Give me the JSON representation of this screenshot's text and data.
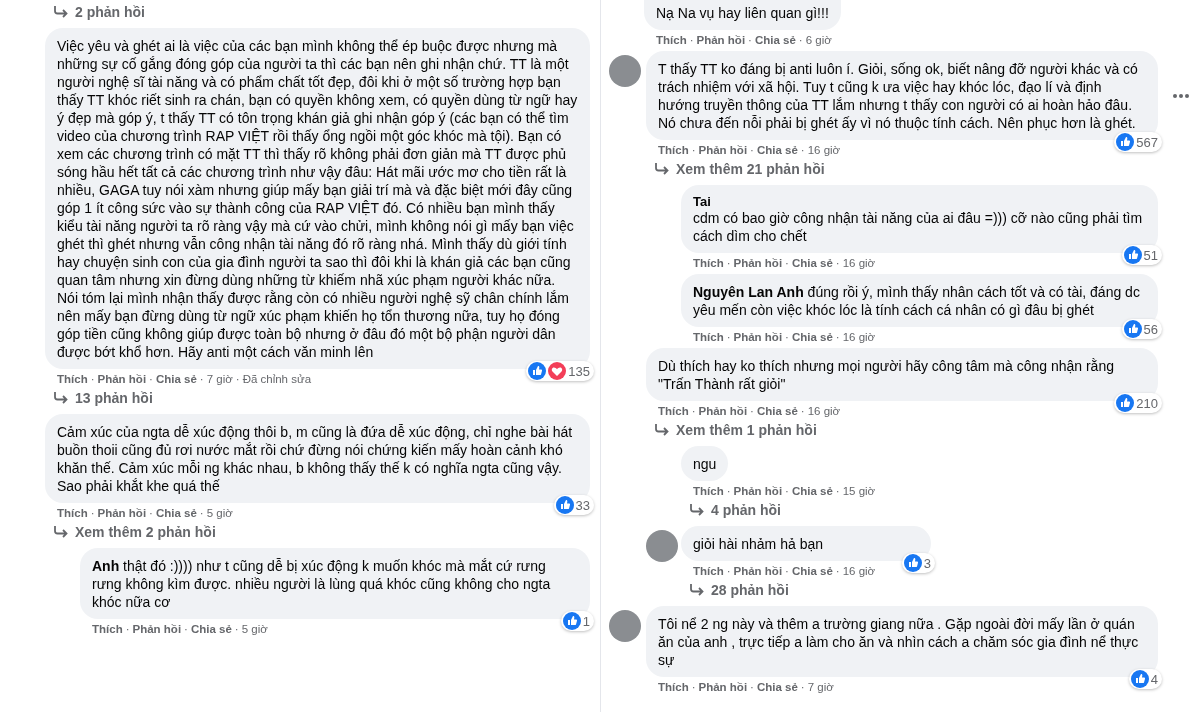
{
  "separator": "·",
  "columns": [
    {
      "items": [
        {
          "kind": "more_link",
          "text": "2 phản hồi"
        },
        {
          "kind": "comment",
          "avatar": false,
          "text": "Việc yêu và ghét ai là việc của các bạn mình không thể ép buộc được nhưng mà những sự cố gắng đóng góp của người ta thì các bạn nên ghi nhận chứ. TT là một người nghệ sĩ tài năng và có phẩm chất tốt đẹp, đôi khi ở một số trường hợp bạn thấy TT khóc riết sinh ra chán, bạn có quyền không xem, có quyền dùng từ ngữ hay ý đẹp mà góp ý, t thấy TT có tôn trọng khán giả ghi nhận góp ý (các bạn có thể tìm video của chương trình RAP VIỆT rồi thấy ổng ngồi một góc khóc mà tội). Bạn có xem các chương trình có mặt TT thì thấy rõ không phải đơn giản mà TT được phủ sóng hầu hết tất cả các chương trình như vậy đâu: Hát mãi ước mơ cho tiền rất là nhiều, GAGA tuy nói xàm nhưng giúp mấy bạn giải trí mà và đặc biệt mới đây cũng góp 1 ít công sức vào sự thành công của RAP VIỆT đó. Có nhiều bạn mình thấy kiểu tài năng người ta rõ ràng vậy mà cứ vào chửi, mình không nói gì mấy bạn việc ghét thì ghét nhưng vẫn công nhận tài năng đó rõ ràng nhá. Mình thấy dù giới tính hay chuyện sinh con của gia đình người ta sao thì đôi khi là khán giả các bạn cũng quan tâm nhưng xin đừng dùng những từ khiếm nhã xúc phạm người khác nữa. Nói tóm lại mình nhận thấy được rằng còn có nhiều người nghệ sỹ chân chính lắm nên mấy bạn đừng dùng từ ngữ xúc phạm khiến họ tổn thương nữa, tuy họ đóng góp tiền cũng không giúp được toàn bộ nhưng ở đâu đó một bộ phận người dân được bớt khổ hơn. Hãy anti một cách văn minh lên",
          "actions": [
            "Thích",
            "Phản hồi",
            "Chia sẻ"
          ],
          "time": "7 giờ",
          "edited": "Đã chỉnh sửa",
          "hearts": true,
          "count": "135",
          "more": "13 phản hồi"
        },
        {
          "kind": "comment",
          "avatar": false,
          "text": "Cảm xúc của ngta dễ xúc động thôi b, m cũng là đứa dễ xúc động, chỉ nghe bài hát buồn thoii cũng đủ rơi nước mắt rồi chứ đừng nói chứng kiến mấy hoàn cảnh khó khăn thế. Cảm xúc mỗi ng khác nhau, b không thấy thế k có nghĩa ngta cũng vậy. Sao phải khắt khe quá thế",
          "actions": [
            "Thích",
            "Phản hồi",
            "Chia sẻ"
          ],
          "time": "5 giờ",
          "count": "33",
          "more": "Xem thêm 2 phản hồi",
          "replies": [
            {
              "avatar": false,
              "text": "**Anh** thật đó :)))) như t cũng dễ bị xúc động k muốn khóc mà mắt cứ rưng rưng không kìm được. nhiều người là lùng quá khóc cũng không cho ngta khóc nữa cơ",
              "actions": [
                "Thích",
                "Phản hồi",
                "Chia sẻ"
              ],
              "time": "5 giờ",
              "count": "1"
            }
          ]
        }
      ]
    },
    {
      "items": [
        {
          "kind": "reply",
          "avatar": false,
          "text": "Nạ Na vụ hay liên quan gì!!!",
          "actions": [
            "Thích",
            "Phản hồi",
            "Chia sẻ"
          ],
          "time": "6 giờ"
        },
        {
          "kind": "comment",
          "avatar": true,
          "menu": true,
          "text": "T thấy TT ko đáng bị anti luôn í. Giỏi, sống ok, biết nâng đỡ người khác và có trách nhiệm với xã hội. Tuy t cũng k ưa việc hay khóc lóc, đạo lí và định hướng truyền thông của TT lắm nhưng t thấy con người có ai hoàn hảo đâu. Nó chưa đến nỗi phải bị ghét ấy vì nó thuộc tính cách. Nên phục hơn là ghét.",
          "actions": [
            "Thích",
            "Phản hồi",
            "Chia sẻ"
          ],
          "time": "16 giờ",
          "count": "567",
          "more": "Xem thêm 21 phản hồi",
          "replies": [
            {
              "avatar": false,
              "name": "Tai",
              "text": "cdm có bao giờ công nhận tài năng của ai đâu =))) cỡ nào cũng phải tìm cách dìm cho chết",
              "actions": [
                "Thích",
                "Phản hồi",
                "Chia sẻ"
              ],
              "time": "16 giờ",
              "count": "51"
            },
            {
              "avatar": false,
              "text": "**Nguyên Lan Anh** đúng rồi ý, mình thấy nhân cách tốt và có tài, đáng dc yêu mến còn việc khóc lóc là tính cách cá nhân có gì đâu bị ghét",
              "actions": [
                "Thích",
                "Phản hồi",
                "Chia sẻ"
              ],
              "time": "16 giờ",
              "count": "56"
            }
          ]
        },
        {
          "kind": "comment",
          "avatar": false,
          "text": "Dù thích hay ko thích nhưng mọi người hãy công tâm mà công nhận rằng \"Trấn Thành rất giỏi\"",
          "actions": [
            "Thích",
            "Phản hồi",
            "Chia sẻ"
          ],
          "time": "16 giờ",
          "count": "210",
          "more": "Xem thêm 1 phản hồi",
          "replies": [
            {
              "avatar": false,
              "text": "ngu",
              "actions": [
                "Thích",
                "Phản hồi",
                "Chia sẻ"
              ],
              "time": "15 giờ",
              "more": "4 phản hồi"
            },
            {
              "avatar": true,
              "text": "giỏi hài nhảm hả bạn",
              "actions": [
                "Thích",
                "Phản hồi",
                "Chia sẻ"
              ],
              "time": "16 giờ",
              "count": "3",
              "more": "28 phản hồi"
            }
          ]
        },
        {
          "kind": "comment",
          "avatar": true,
          "text": "Tôi nể 2 ng này và thêm a trường giang nữa . Gặp ngoài đời mấy lần ở quán ăn của anh , trực tiếp a làm cho ăn và nhìn cách a chăm sóc gia đình nể thực sự",
          "actions": [
            "Thích",
            "Phản hồi",
            "Chia sẻ"
          ],
          "time": "7 giờ",
          "count": "4"
        }
      ]
    }
  ]
}
